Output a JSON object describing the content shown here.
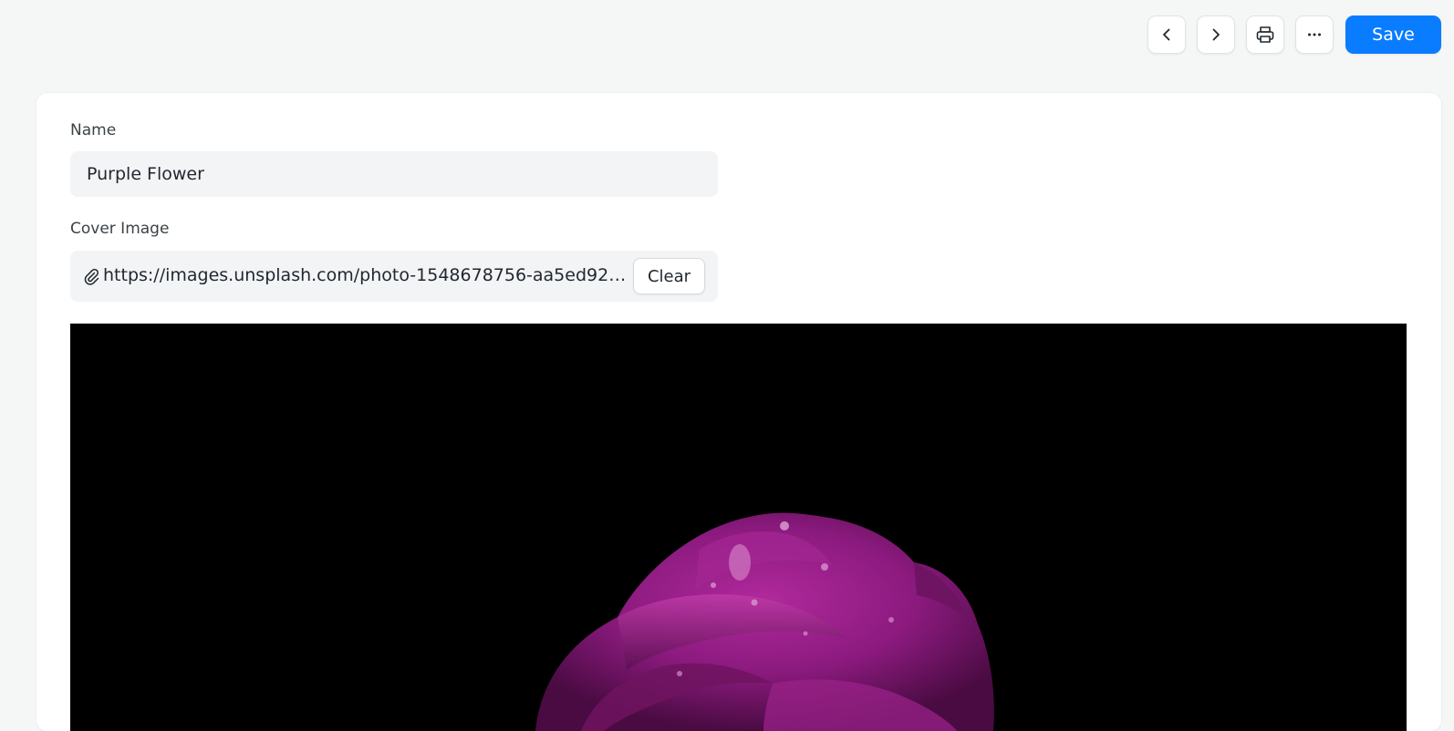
{
  "toolbar": {
    "prev_icon": "chevron-left-icon",
    "next_icon": "chevron-right-icon",
    "print_icon": "printer-icon",
    "more_icon": "more-horizontal-icon",
    "save_label": "Save",
    "accent_color": "#0a7cff"
  },
  "form": {
    "name_label": "Name",
    "name_value": "Purple Flower",
    "cover_label": "Cover Image",
    "cover_url": "https://images.unsplash.com/photo-1548678756-aa5ed92c4...",
    "clear_label": "Clear",
    "attach_icon": "paperclip-icon"
  },
  "preview": {
    "subject": "purple-flower-photo",
    "background_color": "#000000",
    "flower_color": "#8b1a7e"
  }
}
